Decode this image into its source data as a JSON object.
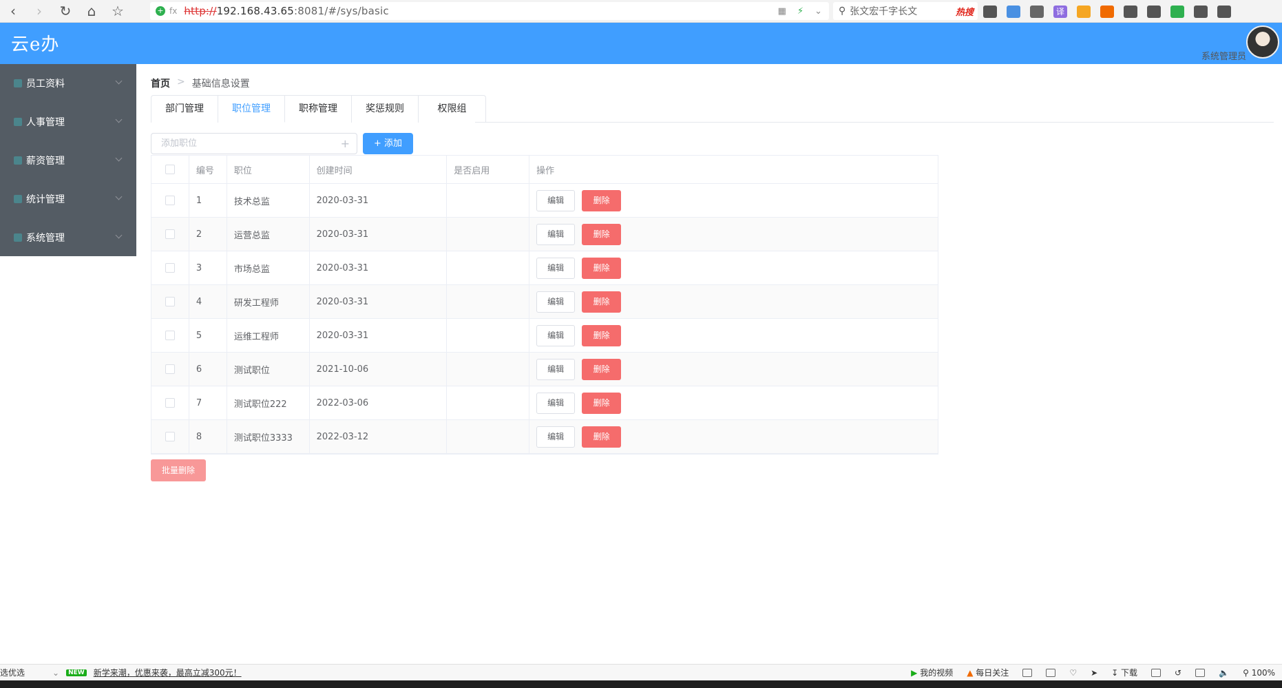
{
  "browser": {
    "url_protocol": "http://",
    "url_host": "192.168.43.65",
    "url_rest": ":8081/#/sys/basic",
    "security_label": "fx",
    "search_text": "张文宏千字长文",
    "search_hot": "热搜",
    "extensions": [
      {
        "name": "book-icon",
        "color": "#555"
      },
      {
        "name": "minus-circle-icon",
        "color": "#4a90e2"
      },
      {
        "name": "scissors-icon",
        "color": "#666"
      },
      {
        "name": "translate-icon",
        "label": "译",
        "color": "#8e6de0"
      },
      {
        "name": "shield-icon",
        "color": "#f5a623"
      },
      {
        "name": "game-icon",
        "color": "#f06a00"
      },
      {
        "name": "grid-icon",
        "color": "#555"
      },
      {
        "name": "sun-icon",
        "color": "#555"
      },
      {
        "name": "battery-icon",
        "color": "#2eb04f"
      },
      {
        "name": "undo-icon",
        "color": "#555"
      },
      {
        "name": "menu-icon",
        "color": "#555"
      }
    ]
  },
  "app": {
    "title": "云e办",
    "user_name": "系统管理员"
  },
  "sidebar": {
    "items": [
      {
        "label": "员工资料"
      },
      {
        "label": "人事管理"
      },
      {
        "label": "薪资管理"
      },
      {
        "label": "统计管理"
      },
      {
        "label": "系统管理"
      }
    ]
  },
  "breadcrumb": {
    "home": "首页",
    "separator": ">",
    "current": "基础信息设置"
  },
  "tabs": [
    {
      "label": "部门管理",
      "active": false
    },
    {
      "label": "职位管理",
      "active": true
    },
    {
      "label": "职称管理",
      "active": false
    },
    {
      "label": "奖惩规则",
      "active": false
    },
    {
      "label": "权限组",
      "active": false
    }
  ],
  "toolbar": {
    "add_placeholder": "添加职位",
    "add_plus": "+",
    "add_button": "+ 添加"
  },
  "table": {
    "headers": [
      "编号",
      "职位",
      "创建时间",
      "是否启用",
      "操作"
    ],
    "edit_label": "编辑",
    "delete_label": "删除",
    "rows": [
      {
        "id": "1",
        "name": "技术总监",
        "created": "2020-03-31",
        "enabled": ""
      },
      {
        "id": "2",
        "name": "运营总监",
        "created": "2020-03-31",
        "enabled": ""
      },
      {
        "id": "3",
        "name": "市场总监",
        "created": "2020-03-31",
        "enabled": ""
      },
      {
        "id": "4",
        "name": "研发工程师",
        "created": "2020-03-31",
        "enabled": ""
      },
      {
        "id": "5",
        "name": "运维工程师",
        "created": "2020-03-31",
        "enabled": ""
      },
      {
        "id": "6",
        "name": "测试职位",
        "created": "2021-10-06",
        "enabled": ""
      },
      {
        "id": "7",
        "name": "测试职位222",
        "created": "2022-03-06",
        "enabled": ""
      },
      {
        "id": "8",
        "name": "测试职位3333",
        "created": "2022-03-12",
        "enabled": ""
      }
    ]
  },
  "batch_delete": "批量删除",
  "statusbar": {
    "left_label": "选优选",
    "new_badge": "NEW",
    "promo": "新学来潮，优惠来袭，最高立减300元！",
    "my_video": "我的视频",
    "daily_follow": "每日关注",
    "download": "下载",
    "zoom": "100%"
  },
  "colors": {
    "header": "#409eff",
    "sidebar": "#545c64",
    "danger": "#f56c6c",
    "primary": "#409eff"
  }
}
